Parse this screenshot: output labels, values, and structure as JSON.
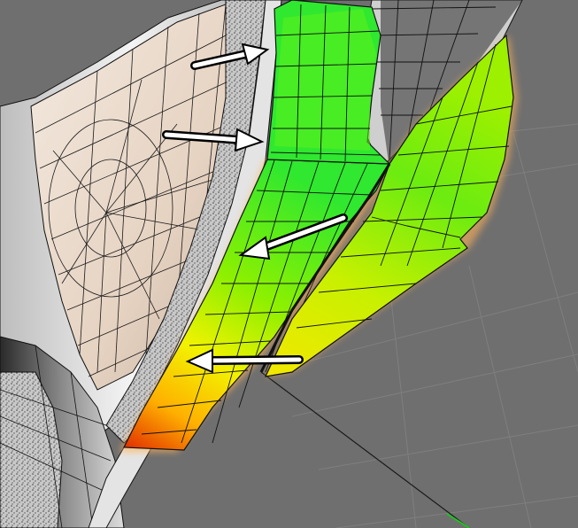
{
  "viewport": {
    "background_color": "#6f6f6f",
    "floor_grid_color": "#7d7d7d",
    "skin_color": "#eadbcd",
    "shell_color": "#d8d8d8",
    "wire_color": "#111111",
    "heatmap_colors": [
      "#e02a00",
      "#ffb000",
      "#f2f200",
      "#8ef000",
      "#2fe82f"
    ],
    "arrow_color": "#ffffff",
    "arrow_outline_color": "#000000",
    "glow_color": "#ffb25a"
  },
  "annotations": {
    "arrow_count": 4
  }
}
